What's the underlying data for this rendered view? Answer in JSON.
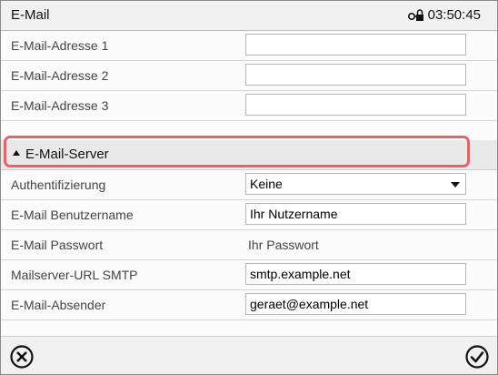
{
  "header": {
    "title": "E-Mail",
    "lock_icon": "lock-icon",
    "time": "03:50:45"
  },
  "email_addresses": [
    {
      "label": "E-Mail-Adresse 1",
      "value": ""
    },
    {
      "label": "E-Mail-Adresse 2",
      "value": ""
    },
    {
      "label": "E-Mail-Adresse 3",
      "value": ""
    }
  ],
  "server_section": {
    "label": "E-Mail-Server",
    "expanded": true,
    "highlight_color": "#e0646a"
  },
  "server": {
    "auth": {
      "label": "Authentifizierung",
      "value": "Keine"
    },
    "username": {
      "label": "E-Mail Benutzername",
      "value": "Ihr Nutzername"
    },
    "password": {
      "label": "E-Mail Passwort",
      "value": "Ihr Passwort"
    },
    "smtp": {
      "label": "Mailserver-URL SMTP",
      "value": "smtp.example.net"
    },
    "sender": {
      "label": "E-Mail-Absender",
      "value": "geraet@example.net"
    }
  },
  "footer": {
    "cancel_icon": "cancel-circle-x-icon",
    "confirm_icon": "confirm-circle-check-icon"
  }
}
